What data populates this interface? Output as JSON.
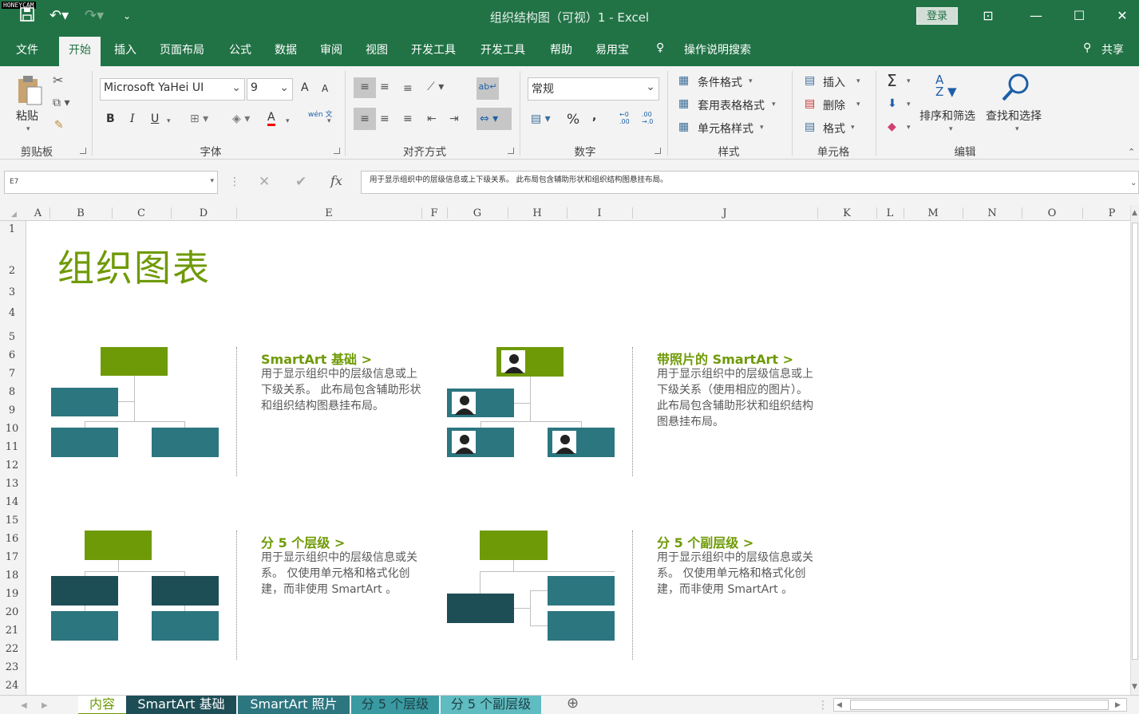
{
  "titlebar": {
    "title": "组织结构图（可视）1  -  Excel",
    "login": "登录",
    "watermark": "HONEYCAM"
  },
  "menu": {
    "items": [
      "文件",
      "开始",
      "插入",
      "页面布局",
      "公式",
      "数据",
      "审阅",
      "视图",
      "开发工具",
      "开发工具",
      "帮助",
      "易用宝"
    ],
    "search": "操作说明搜索",
    "share": "共享",
    "active": "开始"
  },
  "ribbon": {
    "clipboard": {
      "paste": "粘贴",
      "group": "剪贴板"
    },
    "font": {
      "name": "Microsoft YaHei UI",
      "size": "9",
      "group": "字体",
      "bold": "B",
      "italic": "I",
      "underline": "U",
      "grow": "A",
      "shrink": "A",
      "color_a": "A",
      "phonetic": "wén 文"
    },
    "align": {
      "group": "对齐方式"
    },
    "number": {
      "format": "常规",
      "group": "数字",
      "percent": "%",
      "comma": ","
    },
    "styles": {
      "conditional": "条件格式",
      "table": "套用表格格式",
      "cell": "单元格样式",
      "group": "样式"
    },
    "cells": {
      "insert": "插入",
      "delete": "删除",
      "format": "格式",
      "group": "单元格"
    },
    "editing": {
      "sort": "排序和筛选",
      "find": "查找和选择",
      "group": "编辑",
      "sigma": "Σ"
    }
  },
  "formula": {
    "namebox": "E7",
    "content": "用于显示组织中的层级信息或上下级关系。 此布局包含辅助形状和组织结构图悬挂布局。",
    "fx": "fx"
  },
  "columns": [
    "A",
    "B",
    "C",
    "D",
    "E",
    "F",
    "G",
    "H",
    "I",
    "J",
    "K",
    "L",
    "M",
    "N",
    "O",
    "P"
  ],
  "rows": [
    "1",
    "2",
    "3",
    "4",
    "5",
    "6",
    "7",
    "8",
    "9",
    "10",
    "11",
    "12",
    "13",
    "14",
    "15",
    "16",
    "17",
    "18",
    "19",
    "20",
    "21",
    "22",
    "23",
    "24"
  ],
  "sheet": {
    "title": "组织图表",
    "cards": [
      {
        "heading": "SmartArt 基础 >",
        "body": "用于显示组织中的层级信息或上下级关系。 此布局包含辅助形状和组织结构图悬挂布局。"
      },
      {
        "heading": "带照片的 SmartArt >",
        "body": "用于显示组织中的层级信息或上下级关系（使用相应的图片）。 此布局包含辅助形状和组织结构图悬挂布局。"
      },
      {
        "heading": "分 5 个层级 >",
        "body": "用于显示组织中的层级信息或关系。 仅使用单元格和格式化创建，而非使用 SmartArt 。"
      },
      {
        "heading": "分 5 个副层级 >",
        "body": "用于显示组织中的层级信息或关系。 仅使用单元格和格式化创建，而非使用 SmartArt 。"
      }
    ]
  },
  "tabs": [
    {
      "label": "内容",
      "color": "#f3f3f3",
      "text": "#217346"
    },
    {
      "label": "SmartArt 基础",
      "color": "#1d4d55",
      "text": "#ffffff"
    },
    {
      "label": "SmartArt 照片",
      "color": "#2c7680",
      "text": "#ffffff"
    },
    {
      "label": "分 5 个层级",
      "color": "#3a9aa2",
      "text": "#ffffff"
    },
    {
      "label": "分 5 个副层级",
      "color": "#5fbcc0",
      "text": "#ffffff"
    }
  ],
  "colors": {
    "brand": "#217346",
    "green": "#6f9a07",
    "teal": "#2c7680",
    "dark_teal": "#1d4d55"
  }
}
